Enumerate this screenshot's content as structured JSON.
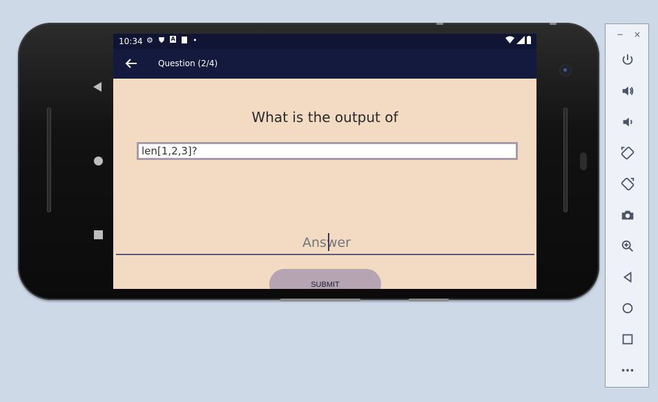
{
  "status_bar": {
    "time": "10:34",
    "notification_icons": [
      "gear-icon",
      "shield-icon",
      "a-icon",
      "sd-card-icon",
      "dot-icon"
    ]
  },
  "app_bar": {
    "title": "Question (2/4)"
  },
  "quiz": {
    "question": "What is the output of",
    "code": "len[1,2,3]?",
    "answer_placeholder": "Answer",
    "submit_label": "SUBMIT"
  },
  "emulator_toolbar": {
    "minimize": "−",
    "close": "×",
    "buttons": [
      "power-icon",
      "volume-up-icon",
      "volume-down-icon",
      "rotate-left-icon",
      "rotate-right-icon",
      "camera-icon",
      "zoom-icon",
      "back-icon",
      "home-icon",
      "overview-icon",
      "more-icon"
    ]
  },
  "colors": {
    "screen_bg": "#f2dac3",
    "app_bar": "#141a3d",
    "submit_bg": "#b6a4b2"
  }
}
